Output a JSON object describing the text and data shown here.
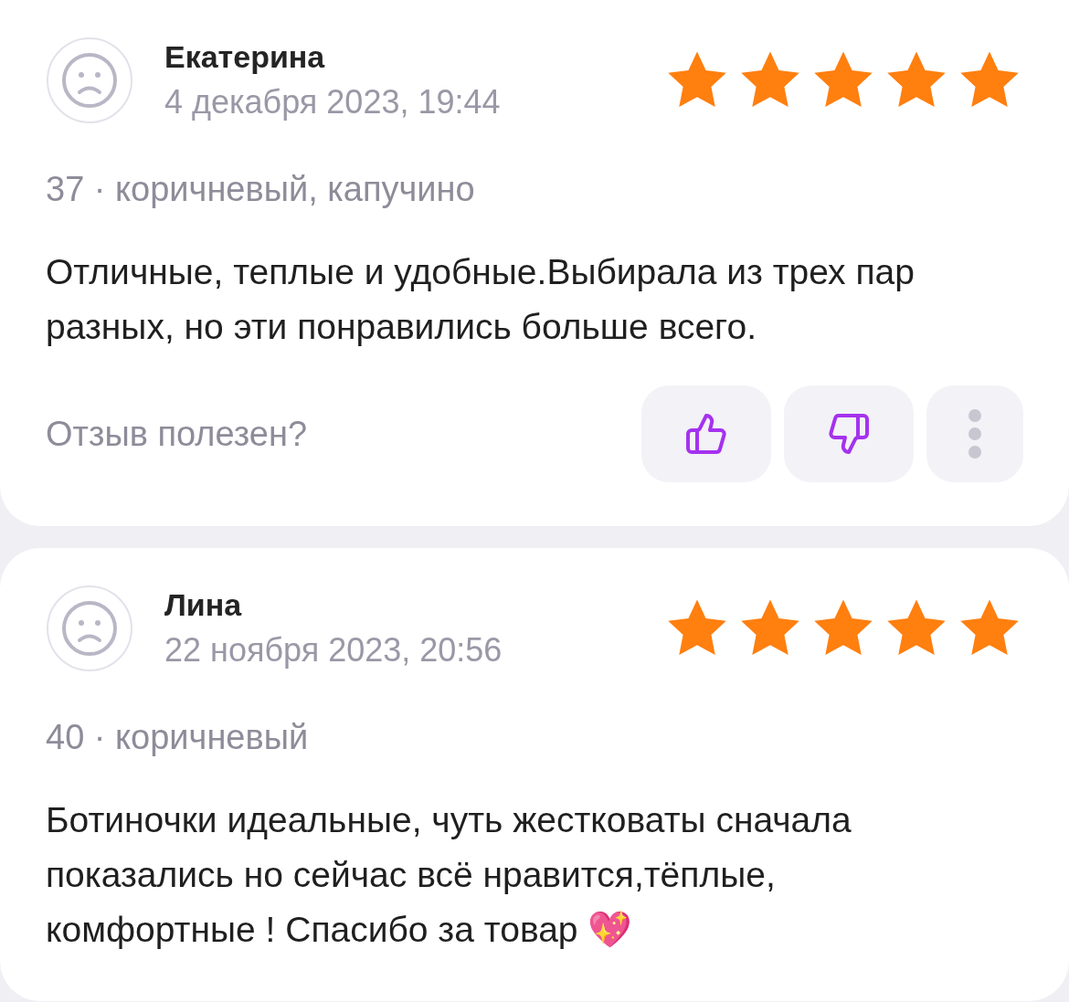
{
  "reviews": [
    {
      "name": "Екатерина",
      "date": "4 декабря 2023, 19:44",
      "stars": 5,
      "variant": "37 · коричневый, капучино",
      "text": "Отличные, теплые и удобные.Выбирала из трех пар разных, но эти понравились больше всего.",
      "helpful": "Отзыв полезен?"
    },
    {
      "name": "Лина",
      "date": "22 ноября 2023, 20:56",
      "stars": 5,
      "variant": "40 · коричневый",
      "text": "Ботиночки идеальные, чуть жестковаты сначала показались но сейчас всё нравится,тёплые, комфортные ! Спасибо за товар 💖"
    }
  ]
}
